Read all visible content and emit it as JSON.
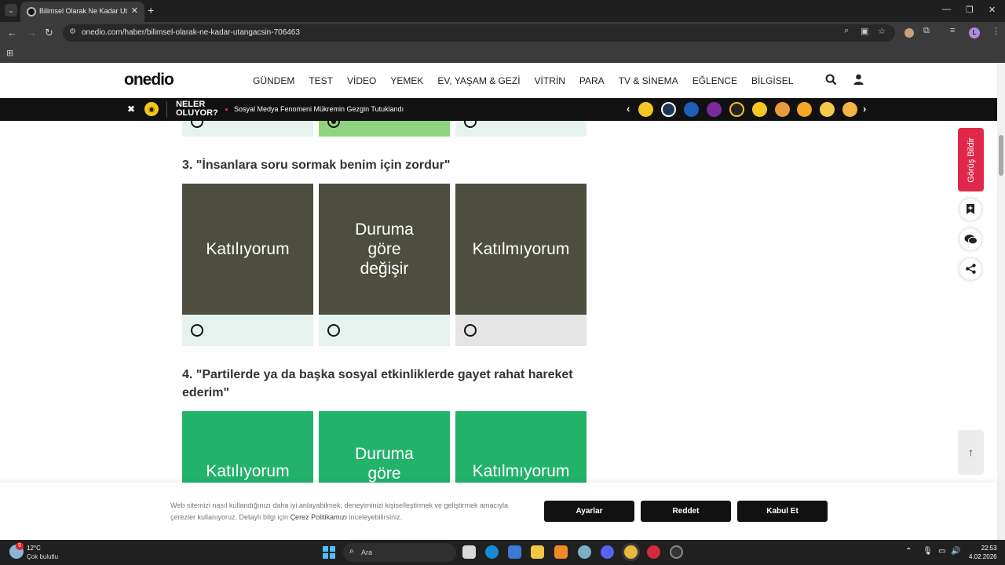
{
  "browser": {
    "tab_title": "Bilimsel Olarak Ne Kadar Utangaçsın?",
    "url": "onedio.com/haber/bilimsel-olarak-ne-kadar-utangacsin-706463",
    "profile_initial": "L"
  },
  "site": {
    "logo": "onedio",
    "nav": [
      "GÜNDEM",
      "TEST",
      "VİDEO",
      "YEMEK",
      "EV, YAŞAM & GEZİ",
      "VİTRİN",
      "PARA",
      "TV & SİNEMA",
      "EĞLENCE",
      "BİLGİSEL"
    ]
  },
  "ticker": {
    "label_line1": "NELER",
    "label_line2": "OLUYOR?",
    "headline": "Sosyal Medya Fenomeni Mükremin Gezgin Tutuklandı"
  },
  "quiz": {
    "q3": {
      "title": "3. \"İnsanlara soru sormak benim için zordur\"",
      "options": [
        "Katılıyorum",
        "Duruma göre değişir",
        "Katılmıyorum"
      ]
    },
    "q4": {
      "title": "4. \"Partilerde ya da başka sosyal etkinliklerde gayet rahat hareket ederim\"",
      "options": [
        "Katılıyorum",
        "Duruma göre",
        "Katılmıyorum"
      ]
    },
    "prev_selected_index": 1
  },
  "sidebar": {
    "feedback": "Görüş Bildir"
  },
  "cookie": {
    "text_before": "Web sitemizi nasıl kullandığınızı daha iyi anlayabilmek, deneyiminizi kişiselleştirmek ve geliştirmek amacıyla çerezler kullanıyoruz. Detaylı bilgi için ",
    "link": "Çerez Politikamızı",
    "text_after": " inceleyebilirsiniz.",
    "btn_settings": "Ayarlar",
    "btn_reject": "Reddet",
    "btn_accept": "Kabul Et"
  },
  "taskbar": {
    "weather_badge": "9",
    "temp": "12°C",
    "weather": "Çok bulutlu",
    "search_placeholder": "Ara",
    "time": "22:53",
    "date": "4.02.2026"
  },
  "colors": {
    "card_dark": "#4d4d40",
    "card_green": "#22b26a",
    "opt_bg": "#e6f2ee",
    "opt_selected": "#8fd47c",
    "feedback_red": "#e0284a"
  }
}
